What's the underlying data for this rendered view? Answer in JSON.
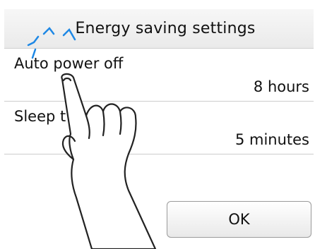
{
  "header": {
    "title": "Energy saving settings"
  },
  "settings": [
    {
      "label": "Auto power off",
      "value": "8 hours"
    },
    {
      "label": "Sleep t",
      "value": "5 minutes"
    }
  ],
  "footer": {
    "ok_label": "OK"
  },
  "icons": {
    "tap": "tap-indicator-icon",
    "hand": "pointing-hand-icon"
  },
  "colors": {
    "tap_indicator": "#1e88e5",
    "title_bar": "#efefef"
  }
}
